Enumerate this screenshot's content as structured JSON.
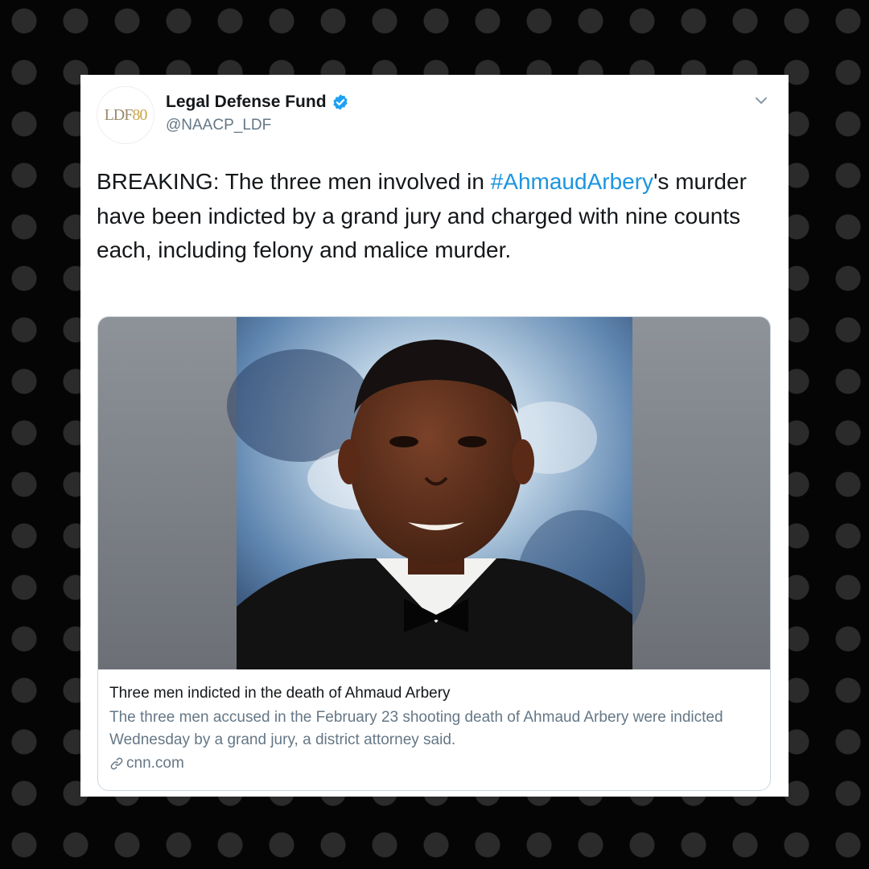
{
  "tweet": {
    "avatar": {
      "prefix": "LDF",
      "suffix": "80"
    },
    "display_name": "Legal Defense Fund",
    "handle": "@NAACP_LDF",
    "text_line1_pre": "BREAKING: The three men involved in ",
    "hashtag": "#AhmaudArbery",
    "text_line1_post": "'s",
    "text_rest": "murder have been indicted by a grand jury and charged with nine counts each, including felony and malice murder."
  },
  "link_card": {
    "title": "Three men indicted in the death of Ahmaud Arbery",
    "description": "The three men accused in the February 23 shooting death of Ahmaud Arbery were indicted Wednesday by a grand jury, a district attorney said.",
    "domain": "cnn.com"
  },
  "colors": {
    "hashtag": "#1b95e0",
    "verified": "#1da1f2",
    "secondary_text": "#657786",
    "page_background": "#050505",
    "dot_pattern": "#2b2b2b"
  },
  "icons": [
    "verified-badge-icon",
    "chevron-down-icon",
    "link-icon"
  ]
}
